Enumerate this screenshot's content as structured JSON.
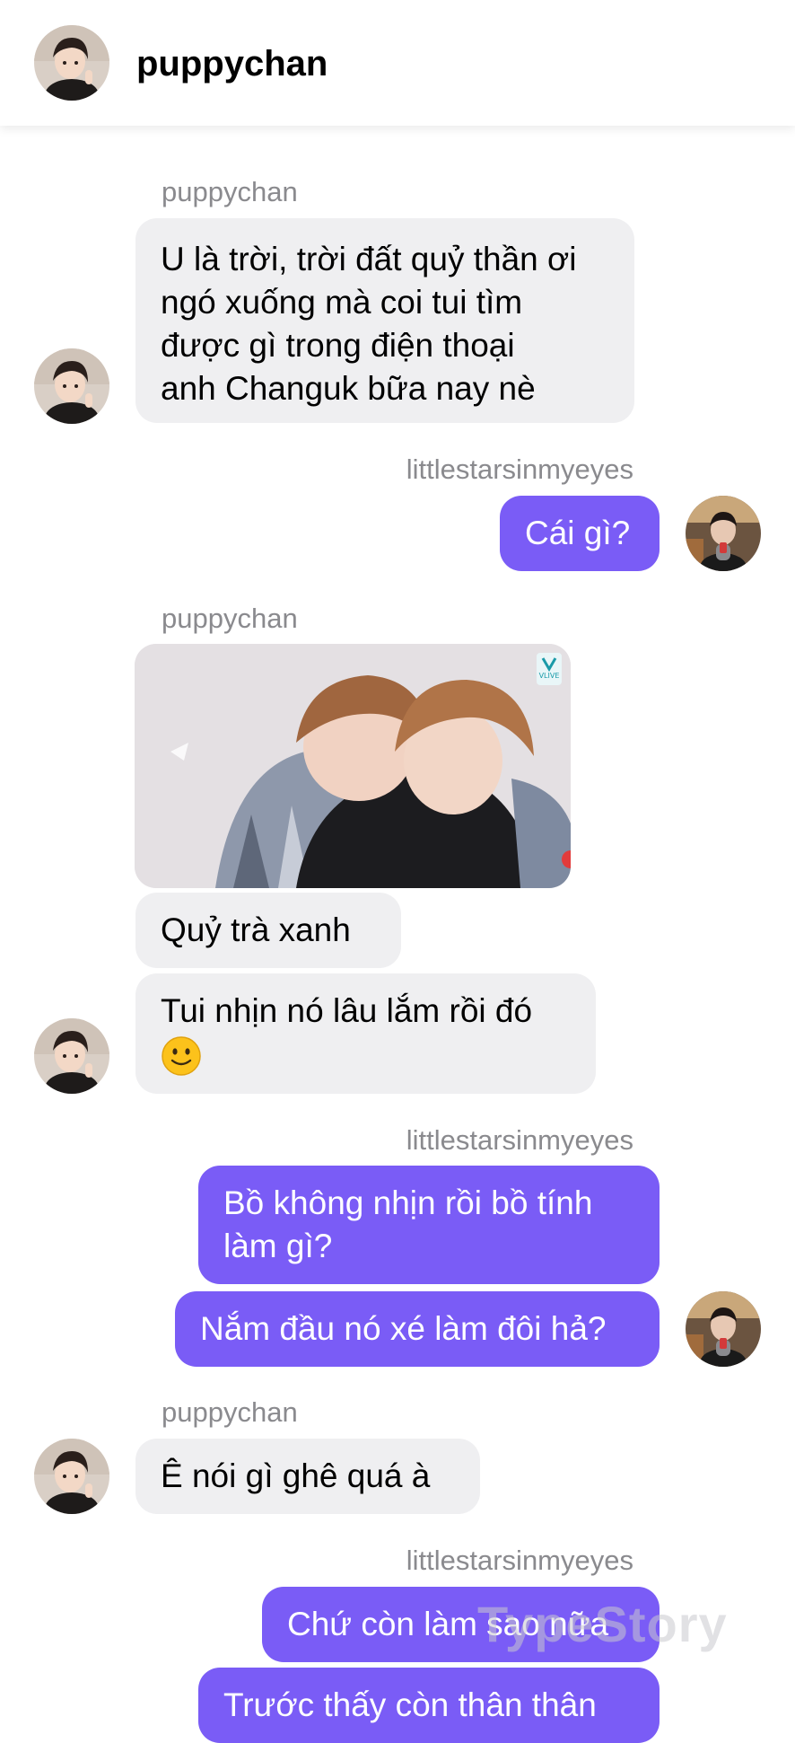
{
  "header": {
    "title": "puppychan"
  },
  "messages": {
    "m1": {
      "sender": "puppychan",
      "lines": [
        "U là trời, trời đất quỷ thần ơi",
        "ngó xuống mà coi tui tìm",
        "được gì trong điện thoại",
        "anh Changuk bữa nay nè"
      ]
    },
    "m2": {
      "sender": "littlestarsinmyeyes",
      "text": "Cái gì?"
    },
    "m3": {
      "sender": "puppychan",
      "photo_badge": "VLIVE",
      "text1": "Quỷ trà xanh",
      "text2_line1": "Tui nhịn nó lâu lắm rồi đó",
      "text2_emoji": "slightly-smiling-face-emoji"
    },
    "m4": {
      "sender": "littlestarsinmyeyes",
      "text1_line1": "Bồ không nhịn rồi bồ tính",
      "text1_line2": "làm gì?",
      "text2": "Nắm đầu nó xé làm đôi hả?"
    },
    "m5": {
      "sender": "puppychan",
      "text": "Ê nói gì ghê quá à"
    },
    "m6": {
      "sender": "littlestarsinmyeyes",
      "text1": "Chứ còn làm sao nữa",
      "text2": "Trước thấy còn thân thân"
    }
  },
  "watermark": "TypeStory",
  "colors": {
    "incoming_bubble": "#efeff1",
    "outgoing_bubble": "#7a5cf6",
    "sender_name": "#8a8a8e"
  }
}
